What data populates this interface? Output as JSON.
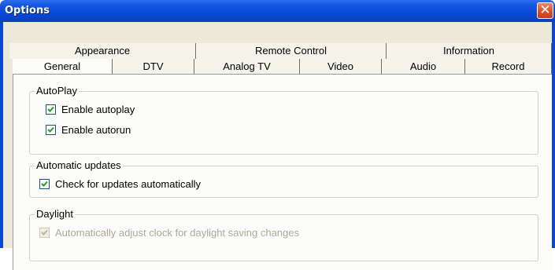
{
  "window": {
    "title": "Options",
    "close_glyph": "✕"
  },
  "tabs": {
    "row1": [
      "Appearance",
      "Remote Control",
      "Information"
    ],
    "row2": [
      "General",
      "DTV",
      "Analog TV",
      "Video",
      "Audio",
      "Record"
    ],
    "active": "General"
  },
  "groups": {
    "autoplay": {
      "label": "AutoPlay",
      "items": [
        {
          "label": "Enable autoplay",
          "checked": true,
          "enabled": true
        },
        {
          "label": "Enable autorun",
          "checked": true,
          "enabled": true
        }
      ]
    },
    "updates": {
      "label": "Automatic updates",
      "items": [
        {
          "label": "Check for updates automatically",
          "checked": true,
          "enabled": true
        }
      ]
    },
    "daylight": {
      "label": "Daylight",
      "items": [
        {
          "label": "Automatically adjust clock for daylight saving changes",
          "checked": true,
          "enabled": false
        }
      ]
    }
  },
  "colors": {
    "titlebar": "#0a49d7",
    "face": "#ece9d8",
    "close": "#d9542f"
  },
  "icons": [
    "close-icon",
    "checkmark-icon"
  ]
}
